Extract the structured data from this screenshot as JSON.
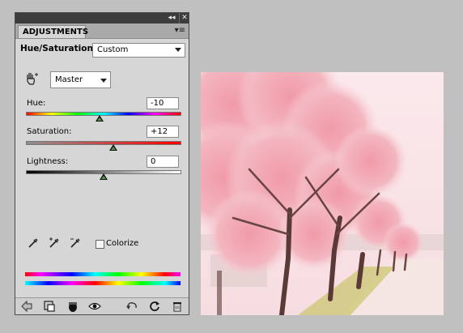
{
  "panel": {
    "tab_label": "ADJUSTMENTS",
    "preset_title": "Hue/Saturation",
    "preset_value": "Custom",
    "channel_value": "Master",
    "hue": {
      "label": "Hue:",
      "value": "-10",
      "level": -10
    },
    "saturation": {
      "label": "Saturation:",
      "value": "+12",
      "level": 12
    },
    "lightness": {
      "label": "Lightness:",
      "value": "0",
      "level": 0
    },
    "colorize_label": "Colorize",
    "colorize_checked": false
  },
  "icons": {
    "titlebar": [
      "collapse-icon",
      "close-icon"
    ],
    "panel_menu": "panel-menu-icon",
    "targeted_adjustment": "hand-adjust-icon",
    "droppers": [
      "eyedropper-icon",
      "eyedropper-plus-icon",
      "eyedropper-minus-icon"
    ],
    "bottom": [
      "return-arrow-icon",
      "clip-layer-icon",
      "visibility-circle-icon",
      "eye-icon",
      "previous-state-icon",
      "reset-icon",
      "trash-icon"
    ]
  },
  "colors": {
    "panel_bg": "#d6d6d6",
    "titlebar_bg": "#3c3c3c",
    "window_bg": "#c0c0c0",
    "slider_thumb_green": "#4f9a4a"
  },
  "photo": {
    "subject": "pink cherry blossom trees lining a path"
  }
}
